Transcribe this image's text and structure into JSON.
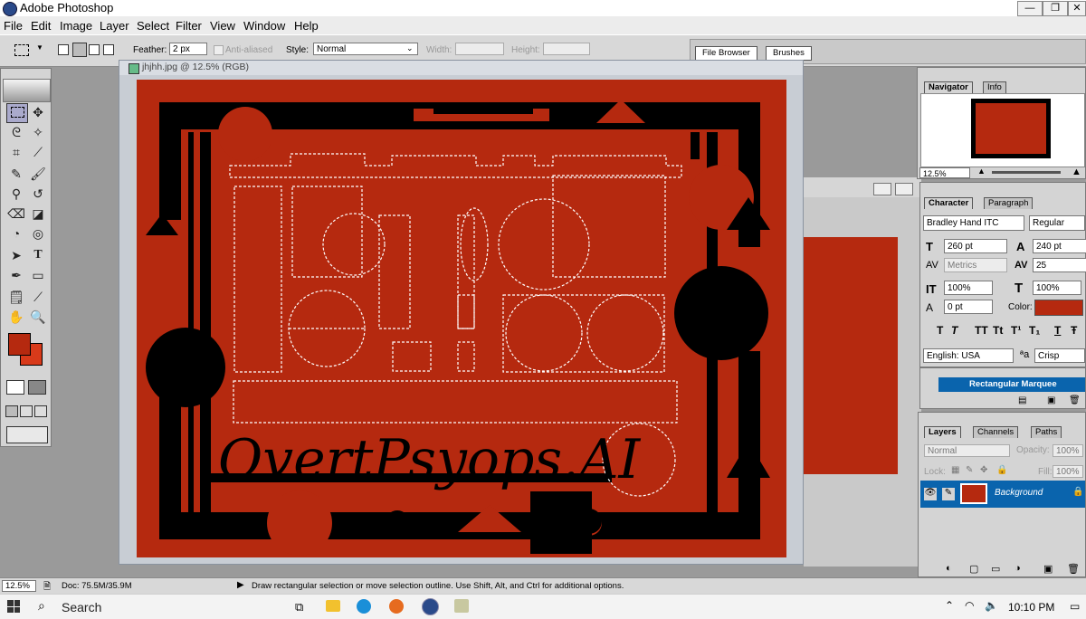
{
  "window": {
    "title": "Adobe Photoshop",
    "min": "—",
    "max": "❐",
    "close": "✕"
  },
  "menu": [
    "File",
    "Edit",
    "Image",
    "Layer",
    "Select",
    "Filter",
    "View",
    "Window",
    "Help"
  ],
  "options": {
    "feather_label": "Feather:",
    "feather_value": "2 px",
    "antialiased_label": "Anti-aliased",
    "style_label": "Style:",
    "style_value": "Normal",
    "width_label": "Width:",
    "height_label": "Height:",
    "file_browser_tab": "File Browser",
    "brushes_tab": "Brushes"
  },
  "document": {
    "title": "jhjhh.jpg @ 12.5% (RGB)",
    "watermark": "OvertPsyops.AI"
  },
  "colors": {
    "accent_blue": "#0a64ad",
    "canvas_red": "#b5290f",
    "foreground": "#b5290f",
    "background": "#d83a1a"
  },
  "navigator": {
    "tab1": "Navigator",
    "tab2": "Info",
    "zoom": "12.5%"
  },
  "character": {
    "tab1": "Character",
    "tab2": "Paragraph",
    "font_family": "Bradley Hand ITC",
    "font_style": "Regular",
    "size": "260 pt",
    "leading": "240 pt",
    "kerning": "Metrics",
    "tracking": "25",
    "vscale": "100%",
    "hscale": "100%",
    "baseline": "0 pt",
    "color_label": "Color:",
    "style_glyphs": [
      "T",
      "T",
      "TT",
      "Tt",
      "T¹",
      "T₁",
      "T",
      "Ŧ"
    ],
    "language": "English: USA",
    "aa_icon": "ªa",
    "antialias": "Crisp"
  },
  "history": {
    "item": "Rectangular Marquee"
  },
  "layers": {
    "tab1": "Layers",
    "tab2": "Channels",
    "tab3": "Paths",
    "blend": "Normal",
    "opacity_label": "Opacity:",
    "opacity": "100%",
    "lock_label": "Lock:",
    "fill_label": "Fill:",
    "fill": "100%",
    "layer_name": "Background"
  },
  "status": {
    "zoom": "12.5%",
    "doc": "Doc: 75.5M/35.9M",
    "hint": "Draw rectangular selection or move selection outline. Use Shift, Alt, and Ctrl for additional options."
  },
  "taskbar": {
    "search": "Search",
    "time": "10:10 PM"
  }
}
